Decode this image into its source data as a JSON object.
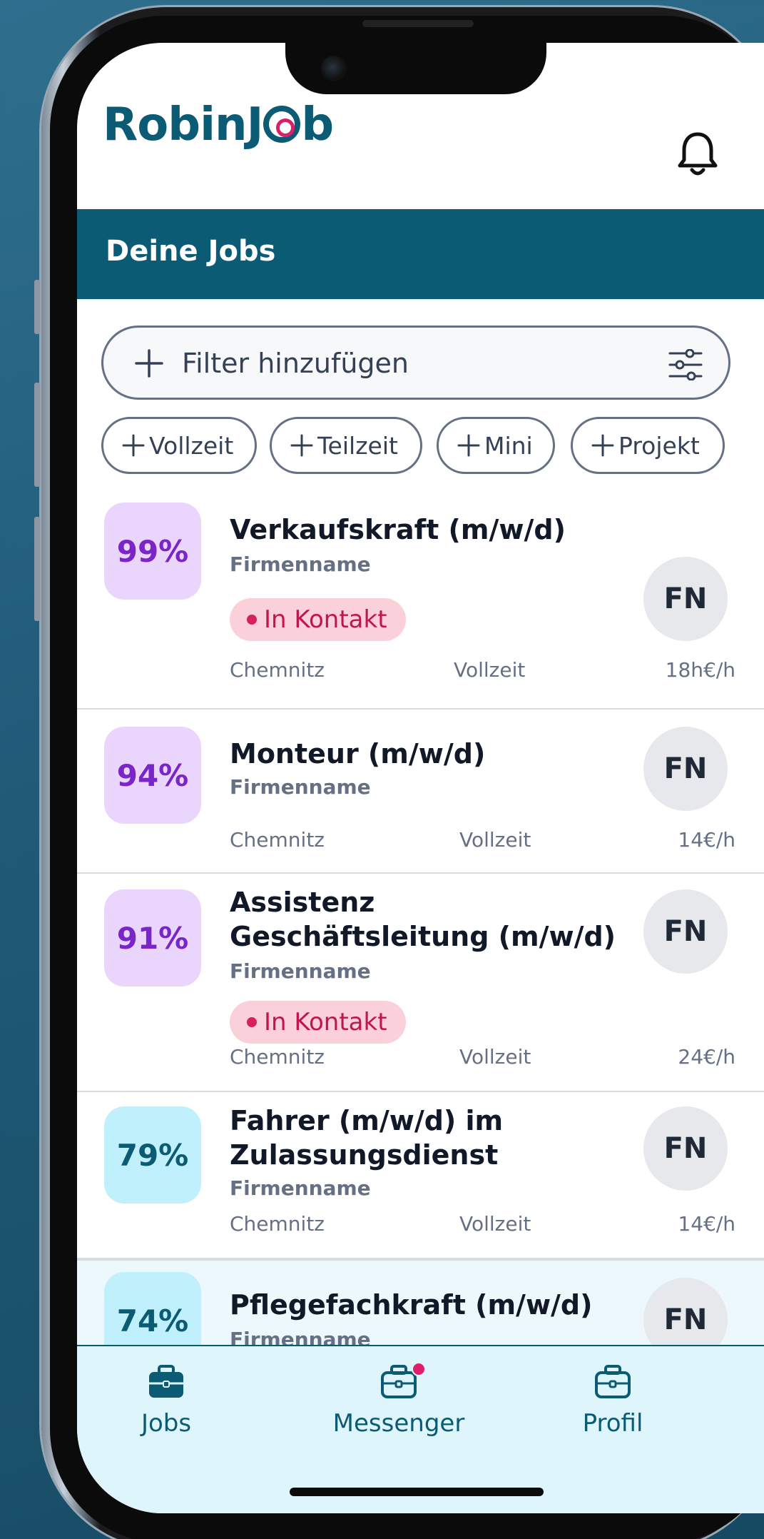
{
  "header": {
    "logo_text_1": "RobinJ",
    "logo_text_2": "b"
  },
  "banner": {
    "title": "Deine Jobs"
  },
  "filter": {
    "label": "Filter hinzufügen",
    "chips": [
      {
        "label": "Vollzeit"
      },
      {
        "label": "Teilzeit"
      },
      {
        "label": "Mini"
      },
      {
        "label": "Projekt"
      }
    ]
  },
  "jobs": [
    {
      "match": "99%",
      "match_color": "purple",
      "title": "Verkaufskraft (m/w/d)",
      "company": "Firmenname",
      "badge": "In Kontakt",
      "location": "Chemnitz",
      "type": "Vollzeit",
      "pay": "18h€/h",
      "avatar": "FN"
    },
    {
      "match": "94%",
      "match_color": "purple",
      "title": "Monteur (m/w/d)",
      "company": "Firmenname",
      "location": "Chemnitz",
      "type": "Vollzeit",
      "pay": "14€/h",
      "avatar": "FN"
    },
    {
      "match": "91%",
      "match_color": "purple",
      "title": "Assistenz Geschäftsleitung (m/w/d)",
      "company": "Firmenname",
      "badge": "In Kontakt",
      "location": "Chemnitz",
      "type": "Vollzeit",
      "pay": "24€/h",
      "avatar": "FN"
    },
    {
      "match": "79%",
      "match_color": "cyan",
      "title": "Fahrer (m/w/d) im Zulassungsdienst",
      "company": "Firmenname",
      "location": "Chemnitz",
      "type": "Vollzeit",
      "pay": "14€/h",
      "avatar": "FN"
    },
    {
      "match": "74%",
      "match_color": "cyan",
      "title": "Pflegefachkraft (m/w/d)",
      "company": "Firmenname",
      "avatar": "FN"
    }
  ],
  "tabbar": {
    "jobs": "Jobs",
    "messenger": "Messenger",
    "profil": "Profil"
  },
  "colors": {
    "brand": "#0b5b74",
    "accent": "#d6226b",
    "match_purple_bg": "#ead5fd",
    "match_cyan_bg": "#bff0fb",
    "badge_bg": "#fad1da"
  }
}
